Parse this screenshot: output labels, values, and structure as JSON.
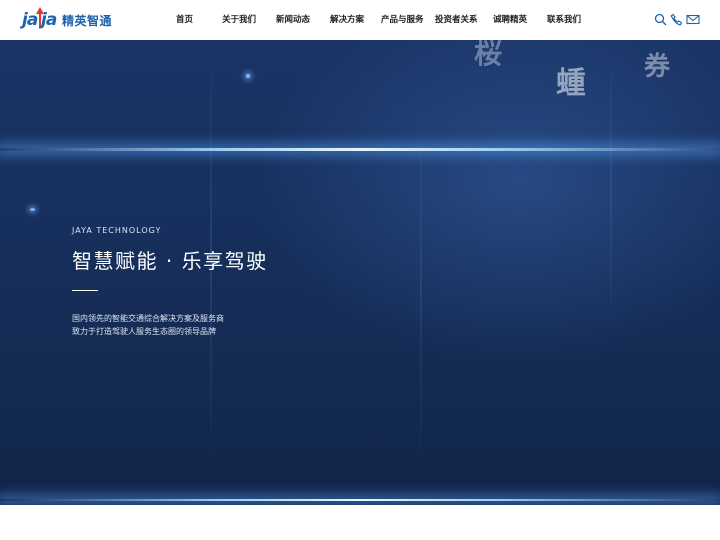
{
  "brand": {
    "logo_mark_left": "ja",
    "logo_mark_right": "ja",
    "name": "精英智通"
  },
  "nav": {
    "items": [
      "首页",
      "关于我们",
      "新闻动态",
      "解决方案",
      "产品与服务",
      "投资者关系",
      "诚聘精英",
      "联系我们"
    ]
  },
  "tools": {
    "icons": [
      "search-icon",
      "phone-icon",
      "mail-icon"
    ]
  },
  "hero": {
    "eyebrow": "JAYA TECHNOLOGY",
    "headline": "智慧赋能 · 乐享驾驶",
    "desc_line1": "国内领先的智能交通综合解决方案及服务商",
    "desc_line2": "致力于打造驾驶人服务生态圈的领导品牌",
    "bg_chars": [
      "桜",
      "蝩",
      "券"
    ]
  },
  "colors": {
    "brand_blue": "#1d63ad",
    "brand_red": "#e23b2d",
    "hero_bg": "#172f5c",
    "beam": "#cfeeff"
  }
}
